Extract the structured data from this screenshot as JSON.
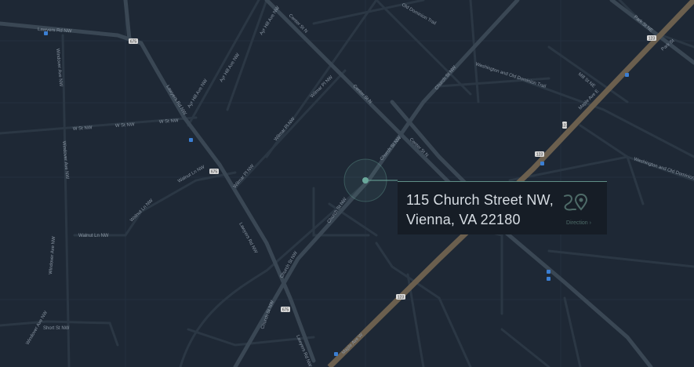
{
  "location": {
    "address_line1": "115 Church Street NW,",
    "address_line2": "Vienna, VA 22180",
    "direction_label": "Direction"
  },
  "map": {
    "colors": {
      "background": "#1e2835",
      "road": "#3a4754",
      "highway": "#6b5f4e",
      "marker": "#6aa89b",
      "transit": "#3b7fd4"
    },
    "road_labels": [
      "Lawyers Rd NW",
      "Lawyers Rd NW",
      "Lawyers Rd NW",
      "Lawyers Rd NW",
      "W St NW",
      "W St NW",
      "W St NW",
      "Ayr Hill Ave NW",
      "Ayr Hill Ave NW",
      "Ayr Hill Ave NW",
      "Walnut Ln NW",
      "Walnut Ln NW",
      "Walnut Ln NW",
      "Windover Ave NW",
      "Windover Ave NW",
      "Windover Ave NW",
      "Windover Ave NW",
      "Short St NW",
      "Center St N",
      "Center St N",
      "Center St N",
      "Church St NW",
      "Church St NW",
      "Church St NW",
      "Church St NW",
      "Church St NW",
      "Wilmar Pl NW",
      "Wilmar Pl NW",
      "Wilmar Pl NW",
      "Maple Ave E",
      "Maple Ave W",
      "Washington and Old Dominion Trail",
      "Washington and Old Dominion Trail",
      "Old Dominion Trail",
      "Park St NE",
      "Park St",
      "Mill St NE"
    ],
    "route_numbers": [
      "675",
      "675",
      "675",
      "123",
      "123",
      "123",
      "123"
    ],
    "icons": [
      "location-marker-icon",
      "transit-stop-icon",
      "route-direction-icon"
    ]
  }
}
